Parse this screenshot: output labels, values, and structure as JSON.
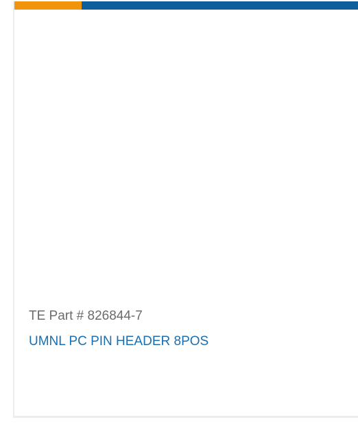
{
  "card": {
    "part_number_label": "TE Part # 826844-7",
    "title": "UMNL PC PIN HEADER 8POS"
  },
  "colors": {
    "accent_orange": "#f0940c",
    "accent_blue": "#0f5f9c",
    "link_blue": "#1a6fb0",
    "muted_text": "#6b6b6b"
  }
}
